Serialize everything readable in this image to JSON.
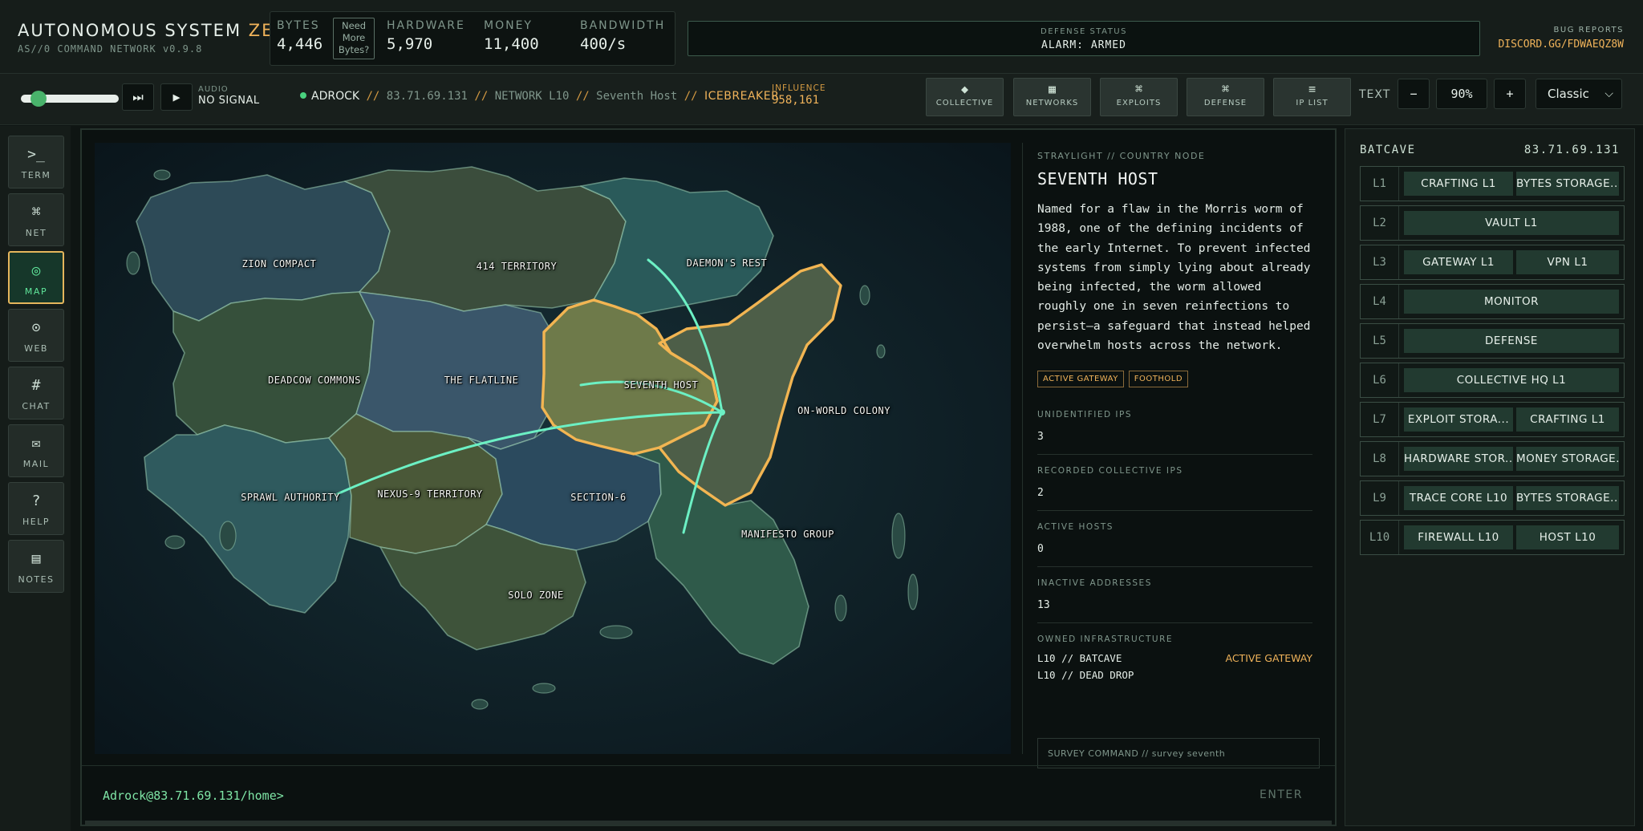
{
  "brand": {
    "title_main": "AUTONOMOUS SYSTEM",
    "title_accent": "ZERO",
    "subtitle_prefix": "AS//0 COMMAND NETWORK",
    "version": "v0.9.8"
  },
  "resources": {
    "bytes": {
      "label": "BYTES",
      "value": "4,446"
    },
    "need_more": [
      "Need",
      "More",
      "Bytes?"
    ],
    "hardware": {
      "label": "HARDWARE",
      "value": "5,970"
    },
    "money": {
      "label": "MONEY",
      "value": "11,400"
    },
    "bandwidth": {
      "label": "BANDWIDTH",
      "value": "400/s"
    }
  },
  "defense_status": {
    "label": "DEFENSE STATUS",
    "value": "ALARM: ARMED"
  },
  "bug_reports": {
    "label": "BUG REPORTS",
    "value": "DISCORD.GG/FDWAEQZ8W"
  },
  "audio": {
    "label": "AUDIO",
    "status": "NO SIGNAL",
    "volume": 0.1
  },
  "breadcrumb": {
    "user": "ADROCK",
    "ip": "83.71.69.131",
    "network": "NETWORK L10",
    "host": "Seventh Host",
    "tool": "ICEBREAKER",
    "sep": "//"
  },
  "influence": {
    "label": "INFLUENCE",
    "value": "958,161"
  },
  "nav_buttons": [
    {
      "icon": "◆",
      "label": "COLLECTIVE"
    },
    {
      "icon": "▦",
      "label": "NETWORKS"
    },
    {
      "icon": "⌘",
      "label": "EXPLOITS"
    },
    {
      "icon": "⌘",
      "label": "DEFENSE"
    },
    {
      "icon": "≡",
      "label": "IP LIST"
    }
  ],
  "text_control": {
    "label": "TEXT",
    "minus": "−",
    "value": "90%",
    "plus": "+"
  },
  "theme_select": {
    "value": "Classic"
  },
  "sidebar": [
    {
      "icon": ">_",
      "label": "TERM"
    },
    {
      "icon": "⌘",
      "label": "NET"
    },
    {
      "icon": "◎",
      "label": "MAP"
    },
    {
      "icon": "⊙",
      "label": "WEB"
    },
    {
      "icon": "#",
      "label": "CHAT"
    },
    {
      "icon": "✉",
      "label": "MAIL"
    },
    {
      "icon": "?",
      "label": "HELP"
    },
    {
      "icon": "▤",
      "label": "NOTES"
    }
  ],
  "map": {
    "regions": [
      "ZION COMPACT",
      "414 TERRITORY",
      "DAEMON'S REST",
      "DEADCOW COMMONS",
      "THE FLATLINE",
      "SEVENTH HOST",
      "ON-WORLD COLONY",
      "SPRAWL AUTHORITY",
      "NEXUS-9 TERRITORY",
      "SECTION-6",
      "MANIFESTO GROUP",
      "SOLO ZONE"
    ],
    "selected": "SEVENTH HOST",
    "highlight_color": "#f2b552",
    "link_color": "#6cf0c4"
  },
  "info": {
    "subtitle": "STRAYLIGHT // COUNTRY NODE",
    "title": "SEVENTH HOST",
    "description": "Named for a flaw in the Morris worm of 1988, one of the defining incidents of the early Internet. To prevent infected systems from simply lying about already being infected, the worm allowed roughly one in seven reinfections to persist—a safeguard that instead helped overwhelm hosts across the network.",
    "tags": [
      "ACTIVE GATEWAY",
      "FOOTHOLD"
    ],
    "stats": [
      {
        "label": "UNIDENTIFIED IPS",
        "value": "3"
      },
      {
        "label": "RECORDED COLLECTIVE IPS",
        "value": "2"
      },
      {
        "label": "ACTIVE HOSTS",
        "value": "0"
      },
      {
        "label": "INACTIVE ADDRESSES",
        "value": "13"
      }
    ],
    "owned": {
      "label": "OWNED INFRASTRUCTURE",
      "rows": [
        {
          "name": "L10 // BATCAVE",
          "status": "ACTIVE GATEWAY"
        },
        {
          "name": "L10 // DEAD DROP",
          "status": ""
        }
      ]
    },
    "survey_placeholder": "SURVEY COMMAND // survey seventh"
  },
  "command": {
    "prompt": "Adrock@83.71.69.131/home>",
    "enter": "ENTER"
  },
  "right_panel": {
    "title": "BATCAVE",
    "ip": "83.71.69.131",
    "levels": [
      {
        "level": "L1",
        "cells": [
          "CRAFTING L1",
          "BYTES STORAGE..."
        ]
      },
      {
        "level": "L2",
        "cells": [
          "VAULT L1"
        ]
      },
      {
        "level": "L3",
        "cells": [
          "GATEWAY L1",
          "VPN L1"
        ]
      },
      {
        "level": "L4",
        "cells": [
          "MONITOR"
        ]
      },
      {
        "level": "L5",
        "cells": [
          "DEFENSE"
        ]
      },
      {
        "level": "L6",
        "cells": [
          "COLLECTIVE HQ L1"
        ]
      },
      {
        "level": "L7",
        "cells": [
          "EXPLOIT STORA...",
          "CRAFTING L1"
        ]
      },
      {
        "level": "L8",
        "cells": [
          "HARDWARE STOR...",
          "MONEY STORAGE..."
        ]
      },
      {
        "level": "L9",
        "cells": [
          "TRACE CORE L10",
          "BYTES STORAGE..."
        ]
      },
      {
        "level": "L10",
        "cells": [
          "FIREWALL L10",
          "HOST L10"
        ]
      }
    ]
  }
}
